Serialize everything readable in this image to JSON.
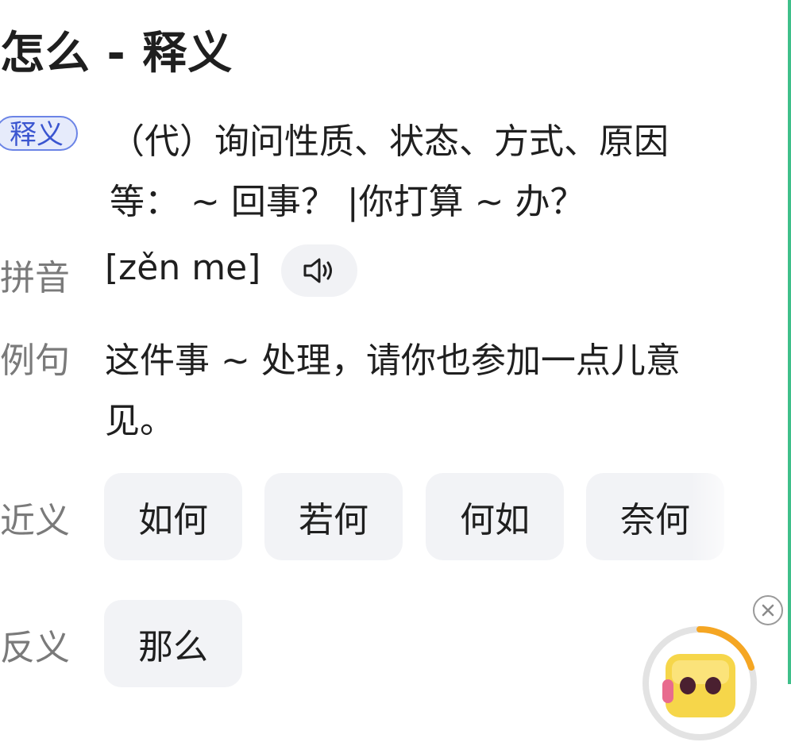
{
  "page": {
    "title": "怎么 - 释义",
    "accent": "#3fbf8a"
  },
  "definition": {
    "badge": "释义",
    "line1": "（代）询问性质、状态、方式、原因",
    "line2": "等：  ~ 回事？ |你打算 ~ 办？"
  },
  "pinyin": {
    "label": "拼音",
    "value": "[zěn me]",
    "audio_icon": "speaker-icon"
  },
  "example": {
    "label": "例句",
    "line1": "这件事 ~ 处理，请你也参加一点儿意",
    "line2": "见。"
  },
  "synonyms": {
    "label": "近义",
    "items": [
      "如何",
      "若何",
      "何如",
      "奈何"
    ]
  },
  "antonyms": {
    "label": "反义",
    "items": [
      "那么"
    ]
  },
  "floating": {
    "close_icon": "close-icon",
    "mascot_icon": "mascot-icon",
    "progress_color": "#f5a623"
  }
}
